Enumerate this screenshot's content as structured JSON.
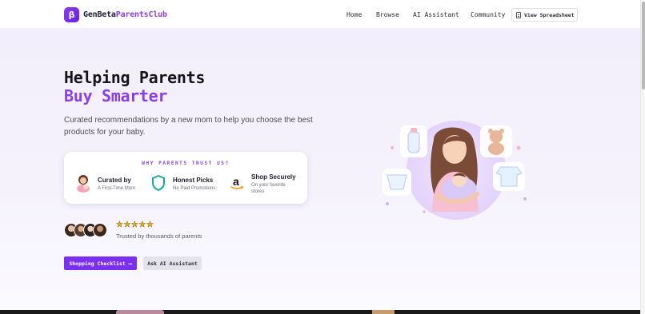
{
  "brand": {
    "badge": "β",
    "name_part1": "GenBeta",
    "name_part2": "ParentsClub"
  },
  "nav": {
    "items": [
      "Home",
      "Browse",
      "AI Assistant",
      "Community"
    ],
    "spreadsheet_label": "View Spreadsheet"
  },
  "hero": {
    "title_line1": "Helping Parents",
    "title_line2": "Buy Smarter",
    "subtitle": "Curated recommendations by a new mom to help you choose the best products for your baby."
  },
  "trust_card": {
    "title": "WHY PARENTS TRUST US?",
    "items": [
      {
        "title": "Curated by",
        "subtitle": "A First-Time Mom",
        "icon": "mom-avatar-icon"
      },
      {
        "title": "Honest Picks",
        "subtitle": "No Paid Promotions",
        "icon": "shield-icon"
      },
      {
        "title": "Shop Securely",
        "subtitle": "On your favorite stores",
        "icon": "amazon-logo-icon"
      }
    ]
  },
  "social_proof": {
    "stars": "★★★★★",
    "rating": 5,
    "text": "Trusted by thousands of parents"
  },
  "actions": {
    "primary": "Shopping Checklist ⟶",
    "secondary": "Ask AI Assistant"
  },
  "colors": {
    "accent": "#8a3ee8",
    "primary_button": "#7b2ff2",
    "star": "#f3b400",
    "shield": "#1aa6a6"
  }
}
